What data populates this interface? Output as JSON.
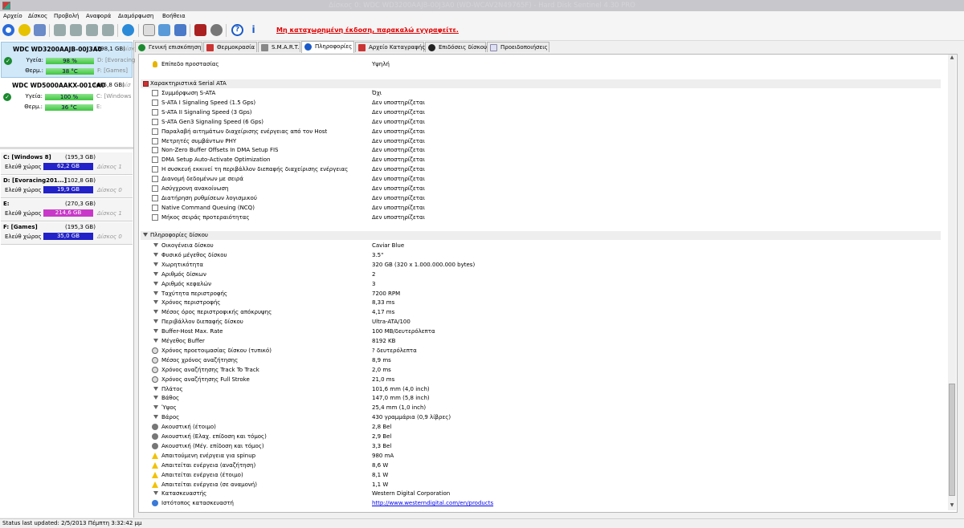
{
  "window": {
    "title": "Δίσκος 0: WDC WD3200AAJB-00J3A0 (WD-WCAV2N49765F) - Hard Disk Sentinel 4.30 PRO"
  },
  "menu": [
    "Αρχείο",
    "Δίσκος",
    "Προβολή",
    "Αναφορά",
    "Διαμόρφωση",
    "Βοήθεια"
  ],
  "toolbar": {
    "unregistered": "Μη καταχωρημένη έκδοση, παρακαλώ εγγραφείτε."
  },
  "disks": [
    {
      "name": "WDC WD3200AAJB-00J3A0",
      "size": "(298,1 GB)",
      "tag": "Δίσκ",
      "health_label": "Υγεία:",
      "health": "98 %",
      "health_fraction": 0.98,
      "temp_label": "Θερμ.:",
      "temp": "38 °C",
      "vol1": "D: [Evoracing",
      "vol2": "F: [Games]"
    },
    {
      "name": "WDC WD5000AAKX-001CA0",
      "size": "(465,8 GB)",
      "tag": "Δίσ",
      "health_label": "Υγεία:",
      "health": "100 %",
      "health_fraction": 1.0,
      "temp_label": "Θερμ.:",
      "temp": "36 °C",
      "vol1": "C: [Windows",
      "vol2": "E:"
    }
  ],
  "partitions": [
    {
      "title": "C: [Windows 8]",
      "size": "(195,3 GB)",
      "free_label": "Ελεύθ χώρος",
      "free": "62,2 GB",
      "free_fraction": 0.32,
      "disk": "Δίσκος 1"
    },
    {
      "title": "D: [Evoracing201...]",
      "size": "(102,8 GB)",
      "free_label": "Ελεύθ χώρος",
      "free": "19,9 GB",
      "free_fraction": 0.19,
      "disk": "Δίσκος 0"
    },
    {
      "title": "E:",
      "size": "(270,3 GB)",
      "free_label": "Ελεύθ χώρος",
      "free": "214,6 GB",
      "free_fraction": 0.79,
      "disk": "Δίσκος 1"
    },
    {
      "title": "F: [Games]",
      "size": "(195,3 GB)",
      "free_label": "Ελεύθ χώρος",
      "free": "35,0 GB",
      "free_fraction": 0.18,
      "disk": "Δίσκος 0"
    }
  ],
  "tabs": [
    "Γενική επισκόπηση",
    "Θερμοκρασία",
    "S.M.A.R.T.",
    "Πληροφορίες",
    "Αρχείο Καταγραφής",
    "Επιδόσεις δίσκου",
    "Προειδοποιήσεις"
  ],
  "info": {
    "top_row": {
      "k": "Επίπεδο προστασίας",
      "v": "Υψηλή"
    },
    "serial_title": "Χαρακτηριστικά Serial ATA",
    "serial": [
      {
        "k": "Συμμόρφωση S-ATA",
        "v": "Όχι"
      },
      {
        "k": "S-ATA I Signaling Speed (1.5 Gps)",
        "v": "Δεν υποστηρίζεται"
      },
      {
        "k": "S-ATA II Signaling Speed (3 Gps)",
        "v": "Δεν υποστηρίζεται"
      },
      {
        "k": "S-ATA Gen3 Signaling Speed (6 Gps)",
        "v": "Δεν υποστηρίζεται"
      },
      {
        "k": "Παραλαβή αιτημάτων διαχείρισης ενέργειας από τον Host",
        "v": "Δεν υποστηρίζεται"
      },
      {
        "k": "Μετρητές συμβάντων PHY",
        "v": "Δεν υποστηρίζεται"
      },
      {
        "k": "Non-Zero Buffer Offsets In DMA Setup FIS",
        "v": "Δεν υποστηρίζεται"
      },
      {
        "k": "DMA Setup Auto-Activate Optimization",
        "v": "Δεν υποστηρίζεται"
      },
      {
        "k": "Η συσκευή εκκινεί τη περιβάλλον διεπαφής διαχείρισης ενέργειας",
        "v": "Δεν υποστηρίζεται"
      },
      {
        "k": "Διανομή δεδομένων με σειρά",
        "v": "Δεν υποστηρίζεται"
      },
      {
        "k": "Ασύγχρονη ανακοίνωση",
        "v": "Δεν υποστηρίζεται"
      },
      {
        "k": "Διατήρηση ρυθμίσεων λογισμικού",
        "v": "Δεν υποστηρίζεται"
      },
      {
        "k": "Native Command Queuing (NCQ)",
        "v": "Δεν υποστηρίζεται"
      },
      {
        "k": "Μήκος σειράς προτεραιότητας",
        "v": "Δεν υποστηρίζεται"
      }
    ],
    "disk_title": "Πληροφορίες δίσκου",
    "disk": [
      {
        "k": "Οικογένεια δίσκου",
        "v": "Caviar Blue",
        "icon": "bullet"
      },
      {
        "k": "Φυσικό μέγεθος δίσκου",
        "v": "3.5\"",
        "icon": "bullet"
      },
      {
        "k": "Χωρητικότητα",
        "v": "320 GB (320 x 1.000.000.000 bytes)",
        "icon": "bullet"
      },
      {
        "k": "Αριθμός δίσκων",
        "v": "2",
        "icon": "bullet"
      },
      {
        "k": "Αριθμός κεφαλών",
        "v": "3",
        "icon": "bullet"
      },
      {
        "k": "Ταχύτητα περιστροφής",
        "v": "7200 RPM",
        "icon": "bullet"
      },
      {
        "k": "Χρόνος περιστροφής",
        "v": "8,33 ms",
        "icon": "bullet"
      },
      {
        "k": "Μέσος όρος περιστροφικής απόκρυψης",
        "v": "4,17 ms",
        "icon": "bullet"
      },
      {
        "k": "Περιβάλλον διεπαφής δίσκου",
        "v": "Ultra-ATA/100",
        "icon": "bullet"
      },
      {
        "k": "Buffer-Host Max. Rate",
        "v": "100 MB/δευτερόλεπτα",
        "icon": "bullet"
      },
      {
        "k": "Μέγεθος Buffer",
        "v": "8192 KB",
        "icon": "bullet"
      },
      {
        "k": "Χρόνος προετοιμασίας δίσκου (τυπικό)",
        "v": "? δευτερόλεπτα",
        "icon": "clock"
      },
      {
        "k": "Μέσος χρόνος αναζήτησης",
        "v": "8,9 ms",
        "icon": "clock"
      },
      {
        "k": "Χρόνος αναζήτησης Track To Track",
        "v": "2,0 ms",
        "icon": "clock"
      },
      {
        "k": "Χρόνος αναζήτησης Full Stroke",
        "v": "21,0 ms",
        "icon": "clock"
      },
      {
        "k": "Πλάτος",
        "v": "101,6 mm (4,0 inch)",
        "icon": "bullet"
      },
      {
        "k": "Βάθος",
        "v": "147,0 mm (5,8 inch)",
        "icon": "bullet"
      },
      {
        "k": "Ύψος",
        "v": "25,4 mm (1,0 inch)",
        "icon": "bullet"
      },
      {
        "k": "Βάρος",
        "v": "430 γραμμάρια (0,9 λίβρες)",
        "icon": "bullet"
      },
      {
        "k": "Ακουστική (έτοιμο)",
        "v": "2,8 Bel",
        "icon": "sound"
      },
      {
        "k": "Ακουστική (Ελαχ. επίδοση και τόμος)",
        "v": "2,9 Bel",
        "icon": "sound"
      },
      {
        "k": "Ακουστική (Μέγ. επίδοση και τόμος)",
        "v": "3,3 Bel",
        "icon": "sound"
      },
      {
        "k": "Απαιτούμενη ενέργεια για spinup",
        "v": "980 mA",
        "icon": "warn"
      },
      {
        "k": "Απαιτείται ενέργεια (αναζήτηση)",
        "v": "8,6 W",
        "icon": "warn"
      },
      {
        "k": "Απαιτείται ενέργεια (έτοιμο)",
        "v": "8,1 W",
        "icon": "warn"
      },
      {
        "k": "Απαιτείται ενέργεια (σε αναμονή)",
        "v": "1,1 W",
        "icon": "warn"
      },
      {
        "k": "Κατασκευαστής",
        "v": "Western Digital Corporation",
        "icon": "bullet"
      },
      {
        "k": "Ιστότοπος κατασκευαστή",
        "v": "http://www.westerndigital.com/en/products",
        "icon": "globe"
      }
    ]
  },
  "status": "Status last updated: 2/5/2013 Πέμπτη 3:32:42 μμ"
}
